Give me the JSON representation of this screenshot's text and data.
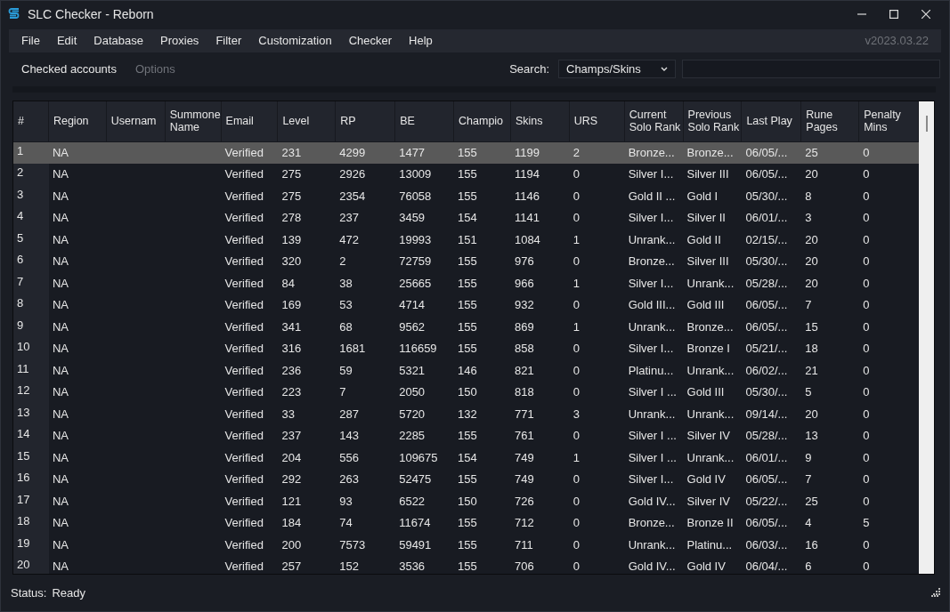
{
  "window": {
    "title": "SLC Checker - Reborn"
  },
  "menu": [
    "File",
    "Edit",
    "Database",
    "Proxies",
    "Filter",
    "Customization",
    "Checker",
    "Help"
  ],
  "version": "v2023.03.22",
  "tabs": [
    {
      "label": "Checked accounts",
      "selected": true
    },
    {
      "label": "Options",
      "selected": false
    }
  ],
  "search": {
    "label": "Search:",
    "mode": "Champs/Skins"
  },
  "table": {
    "columns": [
      "#",
      "Region",
      "Usernam",
      "Summone Name",
      "Email",
      "Level",
      "RP",
      "BE",
      "Champio",
      "Skins",
      "URS",
      "Current Solo Rank",
      "Previous Solo Rank",
      "Last Play",
      "Rune Pages",
      "Penalty Mins"
    ],
    "rows": [
      {
        "num": "1",
        "region": "NA",
        "email": "Verified",
        "level": "231",
        "rp": "4299",
        "be": "1477",
        "champions": "155",
        "skins": "1199",
        "urs": "2",
        "current_solo_rank": "Bronze...",
        "previous_solo_rank": "Bronze...",
        "last_play": "06/05/...",
        "rune_pages": "25",
        "penalty_mins": "0",
        "selected": true
      },
      {
        "num": "2",
        "region": "NA",
        "email": "Verified",
        "level": "275",
        "rp": "2926",
        "be": "13009",
        "champions": "155",
        "skins": "1194",
        "urs": "0",
        "current_solo_rank": "Silver I...",
        "previous_solo_rank": "Silver III",
        "last_play": "06/05/...",
        "rune_pages": "20",
        "penalty_mins": "0",
        "selected": false
      },
      {
        "num": "3",
        "region": "NA",
        "email": "Verified",
        "level": "275",
        "rp": "2354",
        "be": "76058",
        "champions": "155",
        "skins": "1146",
        "urs": "0",
        "current_solo_rank": "Gold II ...",
        "previous_solo_rank": "Gold I",
        "last_play": "05/30/...",
        "rune_pages": "8",
        "penalty_mins": "0",
        "selected": false
      },
      {
        "num": "4",
        "region": "NA",
        "email": "Verified",
        "level": "278",
        "rp": "237",
        "be": "3459",
        "champions": "154",
        "skins": "1141",
        "urs": "0",
        "current_solo_rank": "Silver I...",
        "previous_solo_rank": "Silver II",
        "last_play": "06/01/...",
        "rune_pages": "3",
        "penalty_mins": "0",
        "selected": false
      },
      {
        "num": "5",
        "region": "NA",
        "email": "Verified",
        "level": "139",
        "rp": "472",
        "be": "19993",
        "champions": "151",
        "skins": "1084",
        "urs": "1",
        "current_solo_rank": "Unrank...",
        "previous_solo_rank": "Gold II",
        "last_play": "02/15/...",
        "rune_pages": "20",
        "penalty_mins": "0",
        "selected": false
      },
      {
        "num": "6",
        "region": "NA",
        "email": "Verified",
        "level": "320",
        "rp": "2",
        "be": "72759",
        "champions": "155",
        "skins": "976",
        "urs": "0",
        "current_solo_rank": "Bronze...",
        "previous_solo_rank": "Silver III",
        "last_play": "05/30/...",
        "rune_pages": "20",
        "penalty_mins": "0",
        "selected": false
      },
      {
        "num": "7",
        "region": "NA",
        "email": "Verified",
        "level": "84",
        "rp": "38",
        "be": "25665",
        "champions": "155",
        "skins": "966",
        "urs": "1",
        "current_solo_rank": "Silver I...",
        "previous_solo_rank": "Unrank...",
        "last_play": "05/28/...",
        "rune_pages": "20",
        "penalty_mins": "0",
        "selected": false
      },
      {
        "num": "8",
        "region": "NA",
        "email": "Verified",
        "level": "169",
        "rp": "53",
        "be": "4714",
        "champions": "155",
        "skins": "932",
        "urs": "0",
        "current_solo_rank": "Gold III...",
        "previous_solo_rank": "Gold III",
        "last_play": "06/05/...",
        "rune_pages": "7",
        "penalty_mins": "0",
        "selected": false
      },
      {
        "num": "9",
        "region": "NA",
        "email": "Verified",
        "level": "341",
        "rp": "68",
        "be": "9562",
        "champions": "155",
        "skins": "869",
        "urs": "1",
        "current_solo_rank": "Unrank...",
        "previous_solo_rank": "Bronze...",
        "last_play": "06/05/...",
        "rune_pages": "15",
        "penalty_mins": "0",
        "selected": false
      },
      {
        "num": "10",
        "region": "NA",
        "email": "Verified",
        "level": "316",
        "rp": "1681",
        "be": "116659",
        "champions": "155",
        "skins": "858",
        "urs": "0",
        "current_solo_rank": "Silver I...",
        "previous_solo_rank": "Bronze I",
        "last_play": "05/21/...",
        "rune_pages": "18",
        "penalty_mins": "0",
        "selected": false
      },
      {
        "num": "11",
        "region": "NA",
        "email": "Verified",
        "level": "236",
        "rp": "59",
        "be": "5321",
        "champions": "146",
        "skins": "821",
        "urs": "0",
        "current_solo_rank": "Platinu...",
        "previous_solo_rank": "Unrank...",
        "last_play": "06/02/...",
        "rune_pages": "21",
        "penalty_mins": "0",
        "selected": false
      },
      {
        "num": "12",
        "region": "NA",
        "email": "Verified",
        "level": "223",
        "rp": "7",
        "be": "2050",
        "champions": "150",
        "skins": "818",
        "urs": "0",
        "current_solo_rank": "Silver I ...",
        "previous_solo_rank": "Gold III",
        "last_play": "05/30/...",
        "rune_pages": "5",
        "penalty_mins": "0",
        "selected": false
      },
      {
        "num": "13",
        "region": "NA",
        "email": "Verified",
        "level": "33",
        "rp": "287",
        "be": "5720",
        "champions": "132",
        "skins": "771",
        "urs": "3",
        "current_solo_rank": "Unrank...",
        "previous_solo_rank": "Unrank...",
        "last_play": "09/14/...",
        "rune_pages": "20",
        "penalty_mins": "0",
        "selected": false
      },
      {
        "num": "14",
        "region": "NA",
        "email": "Verified",
        "level": "237",
        "rp": "143",
        "be": "2285",
        "champions": "155",
        "skins": "761",
        "urs": "0",
        "current_solo_rank": "Silver I ...",
        "previous_solo_rank": "Silver IV",
        "last_play": "05/28/...",
        "rune_pages": "13",
        "penalty_mins": "0",
        "selected": false
      },
      {
        "num": "15",
        "region": "NA",
        "email": "Verified",
        "level": "204",
        "rp": "556",
        "be": "109675",
        "champions": "154",
        "skins": "749",
        "urs": "1",
        "current_solo_rank": "Silver I ...",
        "previous_solo_rank": "Unrank...",
        "last_play": "06/01/...",
        "rune_pages": "9",
        "penalty_mins": "0",
        "selected": false
      },
      {
        "num": "16",
        "region": "NA",
        "email": "Verified",
        "level": "292",
        "rp": "263",
        "be": "52475",
        "champions": "155",
        "skins": "749",
        "urs": "0",
        "current_solo_rank": "Silver I...",
        "previous_solo_rank": "Gold IV",
        "last_play": "06/05/...",
        "rune_pages": "7",
        "penalty_mins": "0",
        "selected": false
      },
      {
        "num": "17",
        "region": "NA",
        "email": "Verified",
        "level": "121",
        "rp": "93",
        "be": "6522",
        "champions": "150",
        "skins": "726",
        "urs": "0",
        "current_solo_rank": "Gold IV...",
        "previous_solo_rank": "Silver IV",
        "last_play": "05/22/...",
        "rune_pages": "25",
        "penalty_mins": "0",
        "selected": false
      },
      {
        "num": "18",
        "region": "NA",
        "email": "Verified",
        "level": "184",
        "rp": "74",
        "be": "11674",
        "champions": "155",
        "skins": "712",
        "urs": "0",
        "current_solo_rank": "Bronze...",
        "previous_solo_rank": "Bronze II",
        "last_play": "06/05/...",
        "rune_pages": "4",
        "penalty_mins": "5",
        "selected": false
      },
      {
        "num": "19",
        "region": "NA",
        "email": "Verified",
        "level": "200",
        "rp": "7573",
        "be": "59491",
        "champions": "155",
        "skins": "711",
        "urs": "0",
        "current_solo_rank": "Unrank...",
        "previous_solo_rank": "Platinu...",
        "last_play": "06/03/...",
        "rune_pages": "16",
        "penalty_mins": "0",
        "selected": false
      },
      {
        "num": "20",
        "region": "NA",
        "email": "Verified",
        "level": "257",
        "rp": "152",
        "be": "3536",
        "champions": "155",
        "skins": "706",
        "urs": "0",
        "current_solo_rank": "Gold IV...",
        "previous_solo_rank": "Gold IV",
        "last_play": "06/04/...",
        "rune_pages": "6",
        "penalty_mins": "0",
        "selected": false
      }
    ]
  },
  "status_bar": {
    "label": "Status:",
    "value": "Ready"
  }
}
